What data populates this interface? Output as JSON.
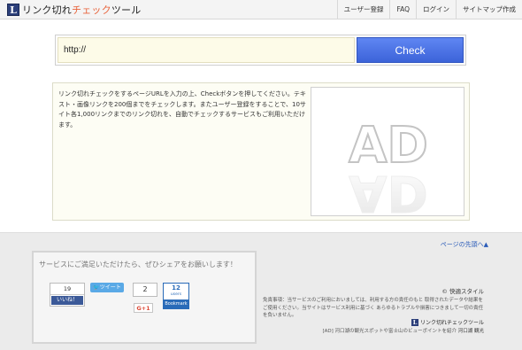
{
  "header": {
    "logo_letter": "L",
    "logo_text_before": "リンク切れ",
    "logo_text_accent": "チェック",
    "logo_text_after": "ツール",
    "nav": [
      "ユーザー登録",
      "FAQ",
      "ログイン",
      "サイトマップ作成"
    ]
  },
  "checker": {
    "url_value": "http://",
    "button_label": "Check"
  },
  "main": {
    "description": "リンク切れチェックをするページURLを入力の上、Checkボタンを押してください。テキスト・画像リンクを200個までをチェックします。またユーザー登録をすることで、10サイト各1,000リンクまでのリンク切れを、自動でチェックするサービスもご利用いただけます。",
    "ad_label": "AD"
  },
  "footer": {
    "page_top": "ページの先頭へ▲",
    "share_title": "サービスにご満足いただけたら、ぜひシェアをお願いします！",
    "like_count": "19",
    "like_label": "いいね！",
    "tweet_label": "ツイート",
    "share_count": "2",
    "gplus_label": "G+1",
    "hatena_count": "12",
    "hatena_users": "users",
    "hatena_label": "Bookmark",
    "copyright": "© 快適スタイル",
    "disclaimer": "免責事項：当サービスのご利用においましては、利用する方の責任のもと 取得されたデータや結果をご使用ください。当サイトはサービス利用に基づく あらゆるトラブルや損害につきまして一切の責任を負いません。",
    "footer_logo_letter": "L",
    "footer_logo_text": "リンク切れチェックツール",
    "ad_line_prefix": "[AD] 河口湖の観光スポットや富士山のビューポイントを紹介",
    "ad_line_link": "河口湖 観光"
  },
  "colors": {
    "accent": "#e8643c",
    "button": "#4a72e6",
    "input_bg": "#fdfbe8",
    "facebook": "#3b5998",
    "twitter": "#5aa9e6",
    "hatena": "#2a6bb8"
  }
}
